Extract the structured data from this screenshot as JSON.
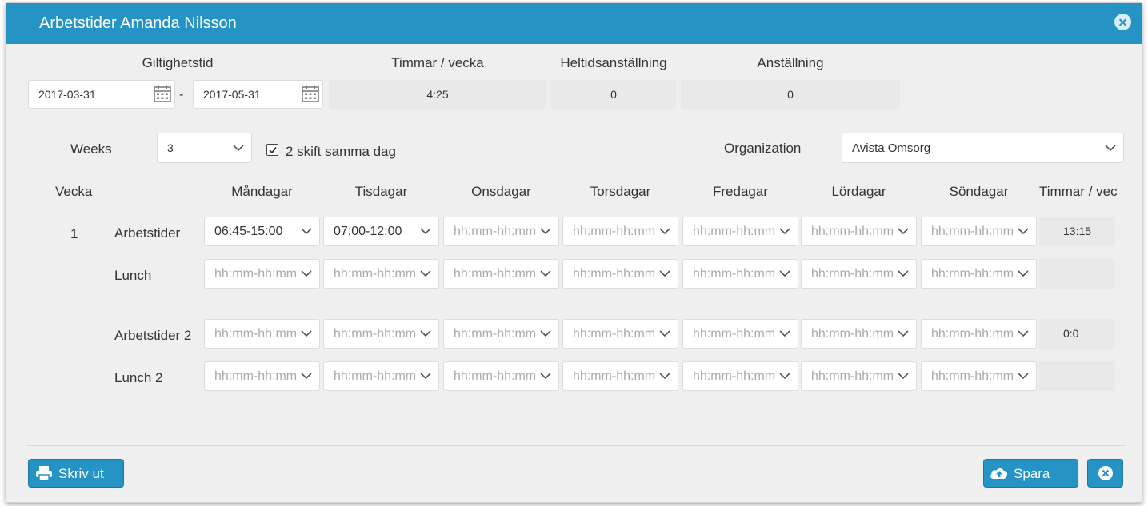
{
  "dialog": {
    "title": "Arbetstider Amanda Nilsson"
  },
  "validity": {
    "label": "Giltighetstid",
    "from": "2017-03-31",
    "separator": "-",
    "to": "2017-05-31"
  },
  "summary": {
    "hours_label": "Timmar / vecka",
    "hours_value": "4:25",
    "fulltime_label": "Heltidsanställning",
    "fulltime_value": "0",
    "employment_label": "Anställning",
    "employment_value": "0"
  },
  "options": {
    "weeks_label": "Weeks",
    "weeks_value": "3",
    "two_shifts_label": "2 skift samma dag",
    "two_shifts_checked": true,
    "organization_label": "Organization",
    "organization_value": "Avista Omsorg"
  },
  "grid": {
    "week_header": "Vecka",
    "days": [
      "Måndagar",
      "Tisdagar",
      "Onsdagar",
      "Torsdagar",
      "Fredagar",
      "Lördagar",
      "Söndagar"
    ],
    "total_header": "Timmar / vec",
    "week_number": "1",
    "placeholder": "hh:mm-hh:mm",
    "rows": [
      {
        "label": "Arbetstider",
        "values": [
          "06:45-15:00",
          "07:00-12:00",
          "",
          "",
          "",
          "",
          ""
        ],
        "total": "13:15"
      },
      {
        "label": "Lunch",
        "values": [
          "",
          "",
          "",
          "",
          "",
          "",
          ""
        ],
        "total": ""
      },
      {
        "label": "Arbetstider 2",
        "values": [
          "",
          "",
          "",
          "",
          "",
          "",
          ""
        ],
        "total": "0:0"
      },
      {
        "label": "Lunch 2",
        "values": [
          "",
          "",
          "",
          "",
          "",
          "",
          ""
        ],
        "total": ""
      }
    ]
  },
  "footer": {
    "print_label": "Skriv ut",
    "save_label": "Spara"
  },
  "icons": {
    "close": "close-circle-icon",
    "calendar": "calendar-icon",
    "print": "printer-icon",
    "save": "cloud-upload-icon"
  },
  "colors": {
    "header": "#2593c3",
    "background": "#efefef"
  }
}
